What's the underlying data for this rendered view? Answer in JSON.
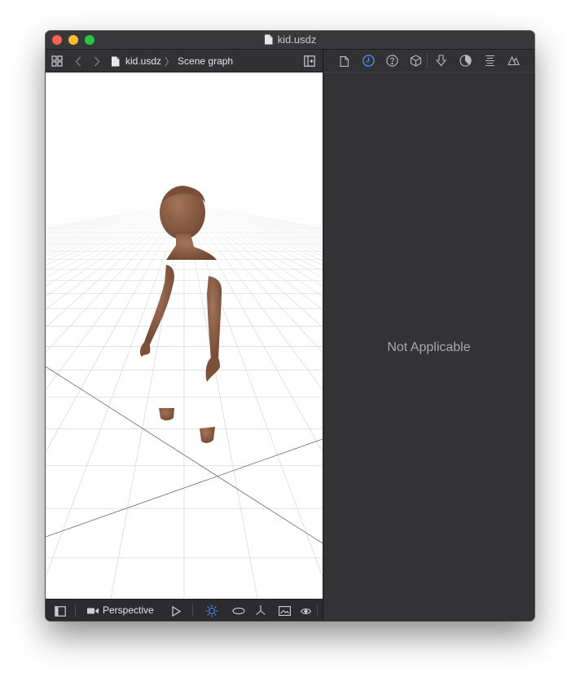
{
  "window": {
    "title": "kid.usdz",
    "traffic_lights": {
      "close": "#fe5f57",
      "minimize": "#febc2e",
      "maximize": "#28c840"
    }
  },
  "toolbar": {
    "breadcrumb": {
      "file": "kid.usdz",
      "section": "Scene graph"
    },
    "icons": [
      "grid-icon",
      "back-chevron-icon",
      "forward-chevron-icon",
      "document-icon",
      "add-panel-icon"
    ]
  },
  "inspector": {
    "tabs": [
      {
        "icon": "file-inspector-icon",
        "active": false
      },
      {
        "icon": "history-inspector-icon",
        "active": true
      },
      {
        "icon": "help-inspector-icon",
        "active": false
      },
      {
        "icon": "node-inspector-icon",
        "active": false
      },
      {
        "icon": "attributes-inspector-icon",
        "active": false
      },
      {
        "icon": "material-inspector-icon",
        "active": false
      },
      {
        "icon": "physics-inspector-icon",
        "active": false
      },
      {
        "icon": "scene-inspector-icon",
        "active": false
      }
    ],
    "empty_message": "Not Applicable",
    "accent_color": "#4d8cf5"
  },
  "bottombar": {
    "camera_label": "Perspective",
    "icons": [
      "sidebar-toggle-icon",
      "camera-icon",
      "play-icon",
      "lighting-icon",
      "orbit-icon",
      "axes-icon",
      "frame-icon",
      "visibility-icon"
    ]
  }
}
